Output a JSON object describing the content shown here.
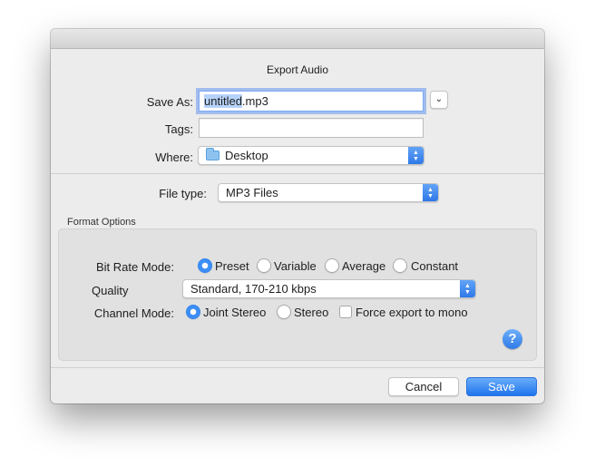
{
  "dialog": {
    "title": "Export Audio",
    "save_as": {
      "label": "Save As:",
      "value_selected": "untitled",
      "value_rest": ".mp3",
      "expand_icon": "chevron-down-icon"
    },
    "tags": {
      "label": "Tags:",
      "value": ""
    },
    "where": {
      "label": "Where:",
      "value": "Desktop",
      "icon": "folder-icon"
    },
    "file_type": {
      "label": "File type:",
      "value": "MP3 Files"
    },
    "format_options": {
      "title": "Format Options",
      "bit_rate_mode": {
        "label": "Bit Rate Mode:",
        "options": [
          "Preset",
          "Variable",
          "Average",
          "Constant"
        ],
        "selected": "Preset"
      },
      "quality": {
        "label": "Quality",
        "value": "Standard, 170-210 kbps"
      },
      "channel_mode": {
        "label": "Channel Mode:",
        "options": [
          "Joint Stereo",
          "Stereo"
        ],
        "selected": "Joint Stereo",
        "force_mono_label": "Force export to mono",
        "force_mono_checked": false
      },
      "help_label": "?"
    },
    "buttons": {
      "cancel": "Cancel",
      "save": "Save"
    }
  },
  "colors": {
    "accent": "#3d8ef5",
    "background": "#ececec",
    "group_box": "#e1e1e1"
  }
}
